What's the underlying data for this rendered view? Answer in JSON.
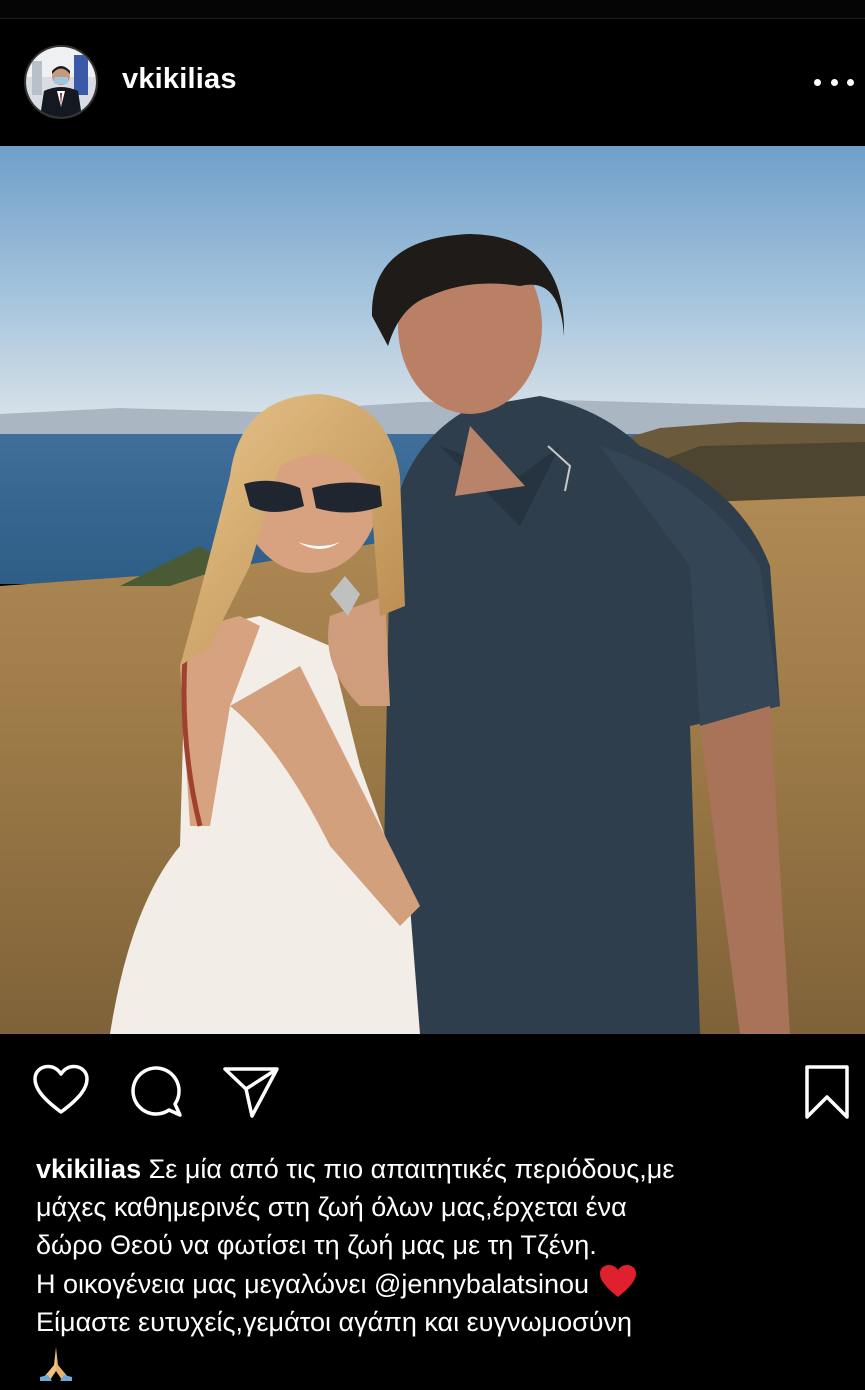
{
  "post": {
    "username": "vkikilias",
    "icons": {
      "avatar": "profile-avatar",
      "more": "more-options-icon",
      "like": "heart-outline-icon",
      "comment": "comment-bubble-icon",
      "share": "paper-plane-icon",
      "save": "bookmark-outline-icon"
    },
    "caption": {
      "username": "vkikilias",
      "line1": "Σε μία από τις πιο απαιτητικές περιόδους,με",
      "line2": "μάχες καθημερινές στη ζωή όλων μας,έρχεται ένα",
      "line3": "δώρο Θεού να φωτίσει τη ζωή μας με τη Τζένη.",
      "line4": "Η οικογένεια μας μεγαλώνει @jennybalatsinou",
      "line5": "Είμαστε ευτυχείς,γεμάτοι αγάπη και ευγνωμοσύνη",
      "emoji_heart": "red-heart-emoji",
      "emoji_pray": "folded-hands-emoji"
    }
  },
  "colors": {
    "background": "#000000",
    "text": "#ffffff",
    "heart_emoji": "#e0212d"
  }
}
